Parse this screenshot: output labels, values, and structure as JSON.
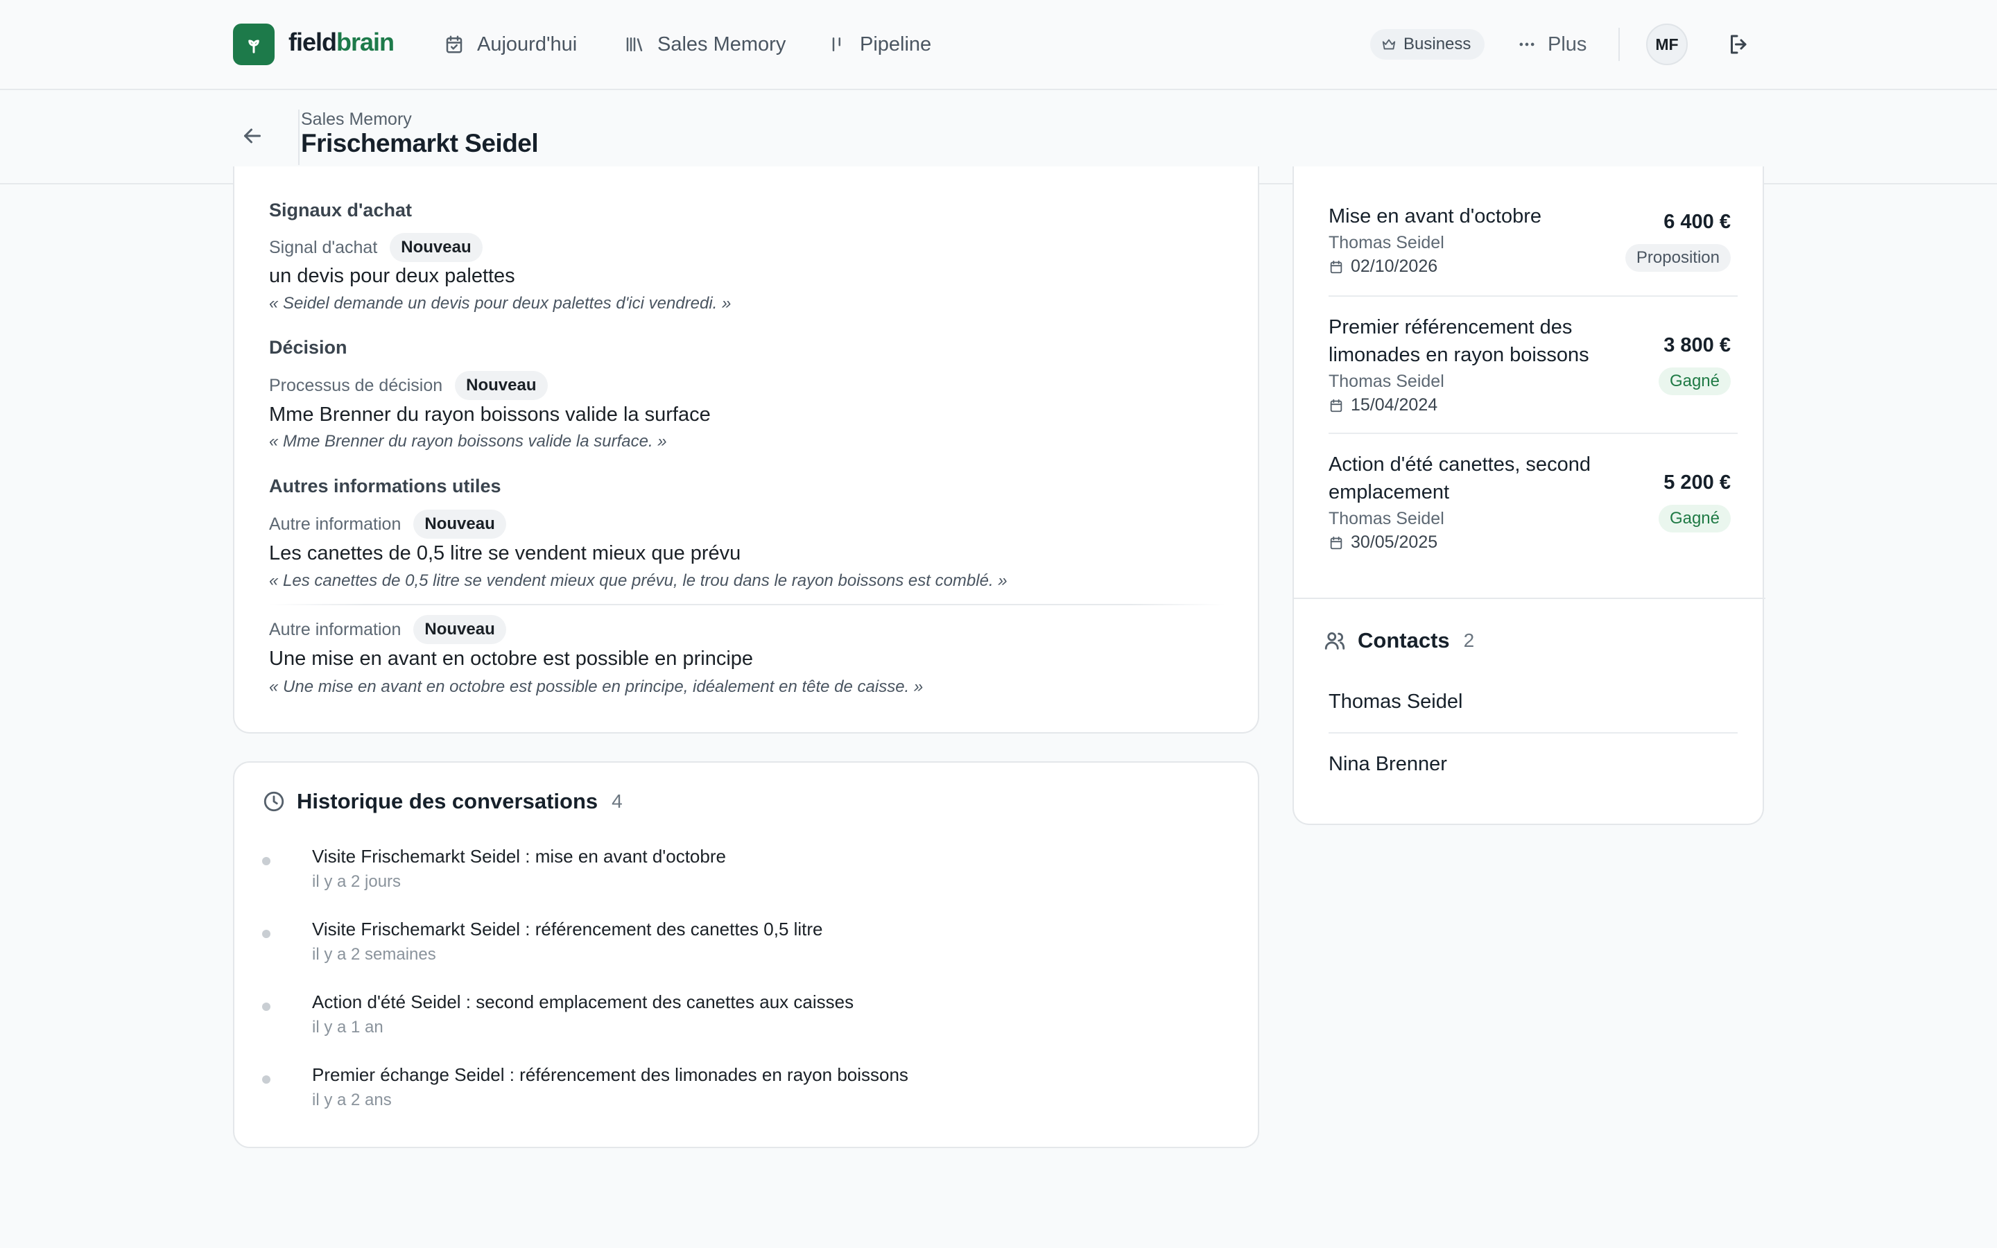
{
  "nav": {
    "brand_part1": "field",
    "brand_part2": "brain",
    "items": [
      {
        "label": "Aujourd'hui"
      },
      {
        "label": "Sales Memory"
      },
      {
        "label": "Pipeline"
      }
    ],
    "plan_label": "Business",
    "more_label": "Plus",
    "avatar_initials": "MF"
  },
  "header": {
    "breadcrumb": "Sales Memory",
    "title": "Frischemarkt Seidel"
  },
  "insights": {
    "sections": [
      {
        "heading": "Signaux d'achat",
        "items": [
          {
            "label": "Signal d'achat",
            "badge": "Nouveau",
            "value": "un devis pour deux palettes",
            "quote": "« Seidel demande un devis pour deux palettes d'ici vendredi. »"
          }
        ]
      },
      {
        "heading": "Décision",
        "items": [
          {
            "label": "Processus de décision",
            "badge": "Nouveau",
            "value": "Mme Brenner du rayon boissons valide la surface",
            "quote": "« Mme Brenner du rayon boissons valide la surface. »"
          }
        ]
      },
      {
        "heading": "Autres informations utiles",
        "items": [
          {
            "label": "Autre information",
            "badge": "Nouveau",
            "value": "Les canettes de 0,5 litre se vendent mieux que prévu",
            "quote": "« Les canettes de 0,5 litre se vendent mieux que prévu, le trou dans le rayon boissons est comblé. »"
          },
          {
            "label": "Autre information",
            "badge": "Nouveau",
            "value": "Une mise en avant en octobre est possible en principe",
            "quote": "« Une mise en avant en octobre est possible en principe, idéalement en tête de caisse. »"
          }
        ]
      }
    ]
  },
  "history": {
    "title": "Historique des conversations",
    "count": "4",
    "items": [
      {
        "text": "Visite Frischemarkt Seidel : mise en avant d'octobre",
        "time": "il y a 2 jours"
      },
      {
        "text": "Visite Frischemarkt Seidel : référencement des canettes 0,5 litre",
        "time": "il y a 2 semaines"
      },
      {
        "text": "Action d'été Seidel : second emplacement des canettes aux caisses",
        "time": "il y a 1 an"
      },
      {
        "text": "Premier échange Seidel : référencement des limonades en rayon boissons",
        "time": "il y a 2 ans"
      }
    ]
  },
  "deals": [
    {
      "title": "Mise en avant d'octobre",
      "owner": "Thomas Seidel",
      "date": "02/10/2026",
      "amount": "6 400 €",
      "status": "Proposition"
    },
    {
      "title": "Premier référencement des limonades en rayon boissons",
      "owner": "Thomas Seidel",
      "date": "15/04/2024",
      "amount": "3 800 €",
      "status": "Gagné"
    },
    {
      "title": "Action d'été canettes, second emplacement",
      "owner": "Thomas Seidel",
      "date": "30/05/2025",
      "amount": "5 200 €",
      "status": "Gagné"
    }
  ],
  "contacts": {
    "title": "Contacts",
    "count": "2",
    "items": [
      {
        "name": "Thomas Seidel"
      },
      {
        "name": "Nina Brenner"
      }
    ]
  },
  "colors": {
    "brand": "#1d7a4a",
    "won": "#1f7a45",
    "won_bg": "#eaf6ee"
  },
  "icons": [
    "leaf-logo-icon",
    "calendar-check-icon",
    "library-icon",
    "pipeline-icon",
    "crown-icon",
    "ellipsis-icon",
    "logout-icon",
    "arrow-left-icon",
    "clock-icon",
    "calendar-icon",
    "users-icon"
  ]
}
